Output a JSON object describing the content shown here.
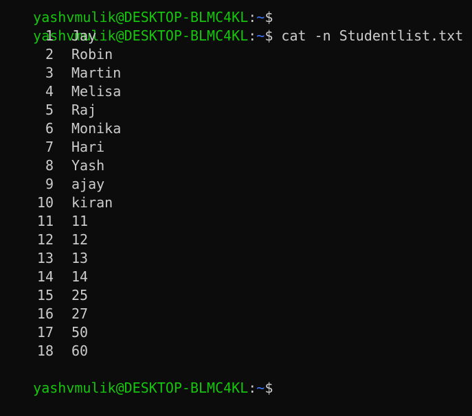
{
  "prev_prompt": {
    "user_host": "yashvmulik@DESKTOP-BLMC4KL",
    "colon": ":",
    "path": "~",
    "symbol": "$"
  },
  "prompt": {
    "user_host": "yashvmulik@DESKTOP-BLMC4KL",
    "colon": ":",
    "path": "~",
    "symbol": "$",
    "command": " cat -n Studentlist.txt"
  },
  "output": [
    {
      "n": "1",
      "text": "Jay"
    },
    {
      "n": "2",
      "text": "Robin"
    },
    {
      "n": "3",
      "text": "Martin"
    },
    {
      "n": "4",
      "text": "Melisa"
    },
    {
      "n": "5",
      "text": "Raj"
    },
    {
      "n": "6",
      "text": "Monika"
    },
    {
      "n": "7",
      "text": "Hari"
    },
    {
      "n": "8",
      "text": "Yash"
    },
    {
      "n": "9",
      "text": "ajay"
    },
    {
      "n": "10",
      "text": "kiran"
    },
    {
      "n": "11",
      "text": "11"
    },
    {
      "n": "12",
      "text": "12"
    },
    {
      "n": "13",
      "text": "13"
    },
    {
      "n": "14",
      "text": "14"
    },
    {
      "n": "15",
      "text": "25"
    },
    {
      "n": "16",
      "text": "27"
    },
    {
      "n": "17",
      "text": "50"
    },
    {
      "n": "18",
      "text": "60"
    }
  ],
  "next_prompt": {
    "user_host": "yashvmulik@DESKTOP-BLMC4KL",
    "colon": ":",
    "path": "~",
    "symbol": "$"
  }
}
